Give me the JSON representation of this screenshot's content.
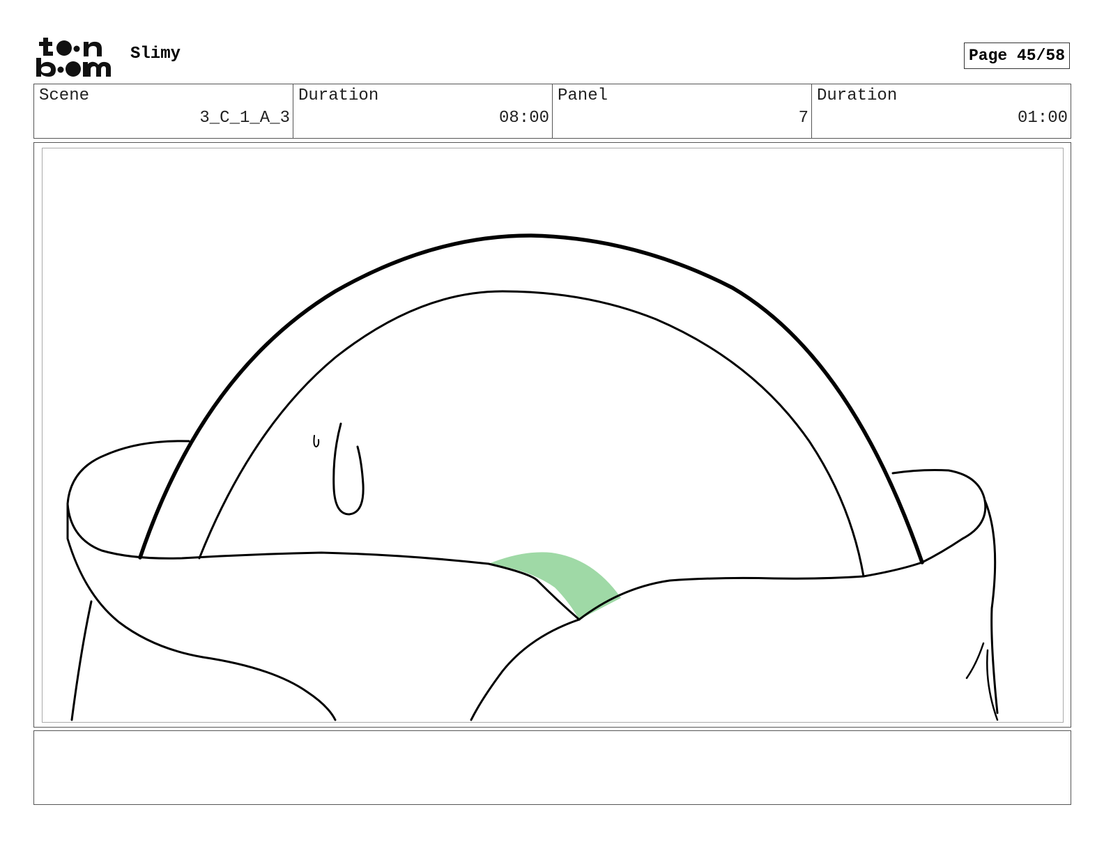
{
  "header": {
    "logo_text": "toon boom",
    "project_title": "Slimy",
    "page_label": "Page 45/58"
  },
  "info": {
    "scene_label": "Scene",
    "scene_value": "3_C_1_A_3",
    "scene_duration_label": "Duration",
    "scene_duration_value": "08:00",
    "panel_label": "Panel",
    "panel_value": "7",
    "panel_duration_label": "Duration",
    "panel_duration_value": "01:00"
  },
  "panel": {
    "drawing": "slime-in-bag-sketch",
    "colors": {
      "slime": "#9fd9a6",
      "line": "#000000"
    }
  },
  "notes": {
    "text": ""
  }
}
